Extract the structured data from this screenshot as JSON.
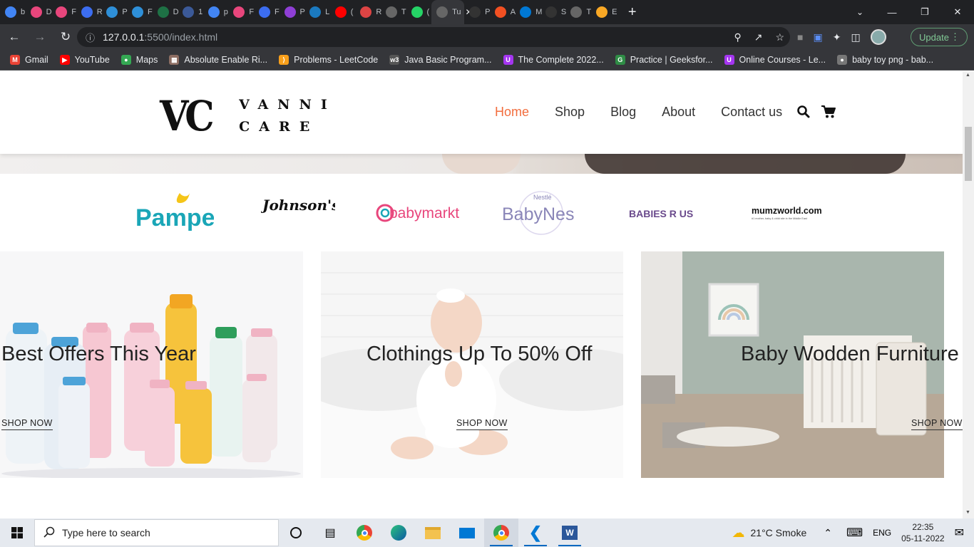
{
  "browser": {
    "tabs": [
      {
        "letter": "b",
        "color": "#4285f4",
        "icon": "google-icon"
      },
      {
        "letter": "D",
        "color": "#e8467c",
        "icon": "flame-icon"
      },
      {
        "letter": "F",
        "color": "#e8467c",
        "icon": "flame-icon"
      },
      {
        "letter": "R",
        "color": "#3c6df0",
        "icon": "gear-icon"
      },
      {
        "letter": "P",
        "color": "#2e8fd8",
        "icon": "w-icon"
      },
      {
        "letter": "F",
        "color": "#2e8fd8",
        "icon": "w-icon"
      },
      {
        "letter": "D",
        "color": "#1e7145",
        "icon": "excel-icon"
      },
      {
        "letter": "1",
        "color": "#3b5998",
        "icon": "doc-icon"
      },
      {
        "letter": "p",
        "color": "#4285f4",
        "icon": "google-icon"
      },
      {
        "letter": "F",
        "color": "#e8467c",
        "icon": "flame-icon"
      },
      {
        "letter": "F",
        "color": "#3c6df0",
        "icon": "flag-icon"
      },
      {
        "letter": "P",
        "color": "#8f3fd6",
        "icon": "b-icon"
      },
      {
        "letter": "L",
        "color": "#1b7ac0",
        "icon": "cn-icon"
      },
      {
        "letter": "(",
        "color": "#ff0000",
        "icon": "youtube-icon"
      },
      {
        "letter": "R",
        "color": "#d44",
        "icon": "image-icon"
      },
      {
        "letter": "T",
        "color": "#666",
        "icon": "globe-icon"
      },
      {
        "letter": "(",
        "color": "#25d366",
        "icon": "whatsapp-icon"
      },
      {
        "letter": "Tu",
        "color": "#666",
        "icon": "globe-icon"
      },
      {
        "letter": "P",
        "color": "#333",
        "icon": "github-icon"
      },
      {
        "letter": "A",
        "color": "#f25022",
        "icon": "microsoft-icon"
      },
      {
        "letter": "M",
        "color": "#0078d4",
        "icon": "outlook-icon"
      },
      {
        "letter": "S",
        "color": "#333",
        "icon": "github-icon"
      },
      {
        "letter": "T",
        "color": "#666",
        "icon": "globe-icon"
      },
      {
        "letter": "E",
        "color": "#f9a825",
        "icon": "books-icon"
      }
    ],
    "active_tab_index": 17,
    "url_host": "127.0.0.1",
    "url_rest": ":5500/index.html",
    "update_label": "Update",
    "bookmarks": [
      {
        "label": "Gmail",
        "color": "#ea4335",
        "icon": "gmail-icon",
        "glyph": "M"
      },
      {
        "label": "YouTube",
        "color": "#ff0000",
        "icon": "youtube-icon",
        "glyph": "▶"
      },
      {
        "label": "Maps",
        "color": "#34a853",
        "icon": "maps-icon",
        "glyph": "●"
      },
      {
        "label": "Absolute Enable Ri...",
        "color": "#8d6e63",
        "icon": "extension-icon",
        "glyph": "▦"
      },
      {
        "label": "Problems - LeetCode",
        "color": "#f89f1b",
        "icon": "leetcode-icon",
        "glyph": "⟩"
      },
      {
        "label": "Java Basic Program...",
        "color": "#555",
        "icon": "w3-icon",
        "glyph": "w3"
      },
      {
        "label": "The Complete 2022...",
        "color": "#a435f0",
        "icon": "udemy-icon",
        "glyph": "U"
      },
      {
        "label": "Practice | Geeksfor...",
        "color": "#2f8d46",
        "icon": "gfg-icon",
        "glyph": "G"
      },
      {
        "label": "Online Courses - Le...",
        "color": "#a435f0",
        "icon": "udemy-icon",
        "glyph": "U"
      },
      {
        "label": "baby toy png - bab...",
        "color": "#777",
        "icon": "globe-icon",
        "glyph": "●"
      }
    ]
  },
  "site": {
    "logo_mark": "VC",
    "logo_line1": "VANNI",
    "logo_line2": "CARE",
    "nav": [
      "Home",
      "Shop",
      "Blog",
      "About",
      "Contact us"
    ],
    "active_nav_index": 0,
    "accent_color": "#f26d3d",
    "brands": [
      "Pampers",
      "Johnson's baby",
      "babymarkt",
      "BabyNes",
      "BABIES R US",
      "mumzworld.com"
    ],
    "brand_subtexts": {
      "babynes_top": "Nestlé",
      "mumzworld_tag": "#1 mother, baby & child site in the Middle East"
    },
    "cards": [
      {
        "title": "Best Offers This Year",
        "cta": "SHOP NOW"
      },
      {
        "title": "Clothings Up To 50% Off",
        "cta": "SHOP NOW"
      },
      {
        "title": "Baby Wodden Furniture",
        "cta": "SHOP NOW"
      }
    ]
  },
  "taskbar": {
    "search_placeholder": "Type here to search",
    "weather": "21°C  Smoke",
    "language": "ENG",
    "time": "22:35",
    "date": "05-11-2022"
  }
}
